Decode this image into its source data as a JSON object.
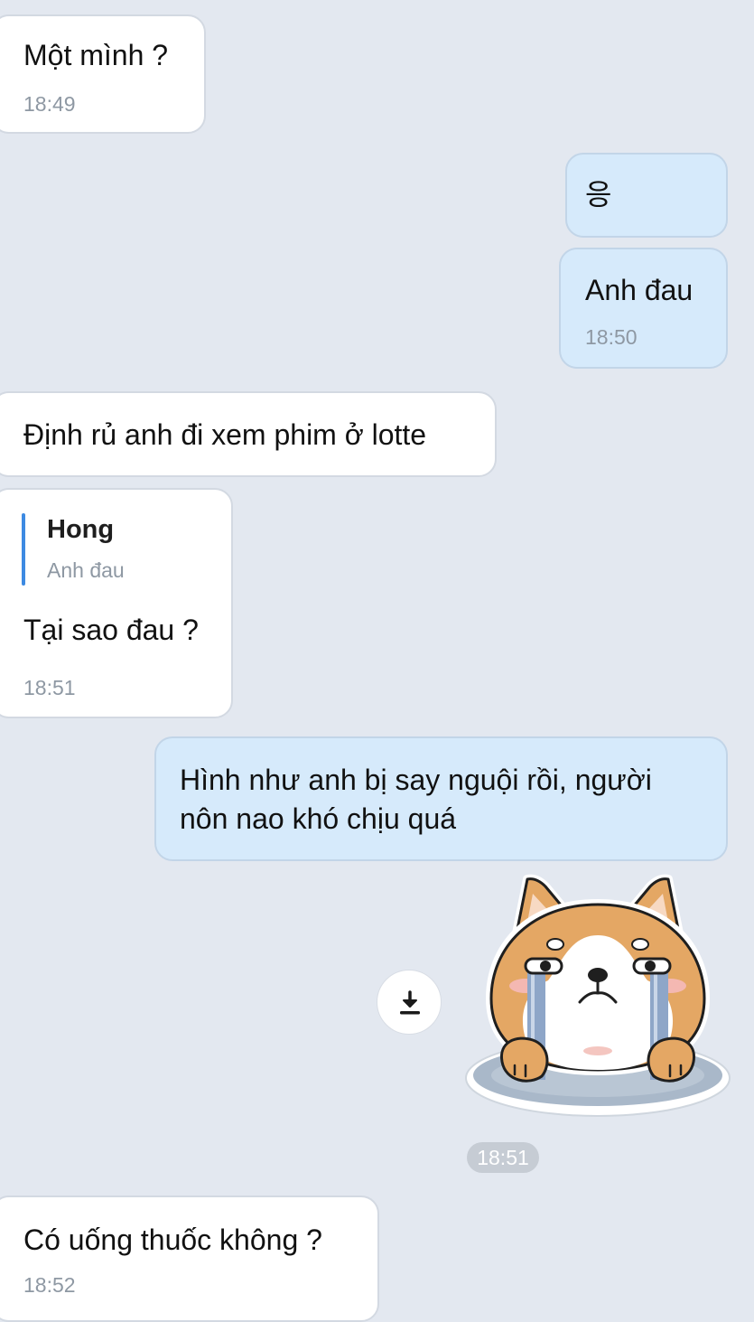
{
  "messages": [
    {
      "text": "Một mình ?",
      "time": "18:49"
    },
    {
      "text": "응"
    },
    {
      "text": "Anh đau",
      "time": "18:50"
    },
    {
      "text": "Định rủ anh đi xem phim ở lotte"
    },
    {
      "quote_name": "Hong",
      "quote_text": "Anh đau",
      "text": "Tại sao đau ?",
      "time": "18:51"
    },
    {
      "text_line1": "Hình như anh bị say nguội rồi, người",
      "text_line2": "nôn nao khó chịu quá"
    },
    {
      "sticker_time": "18:51"
    },
    {
      "text": "Có uống thuốc không ?",
      "time": "18:52"
    }
  ],
  "icons": {
    "download": "download-icon",
    "sticker": "crying-shiba-sticker"
  },
  "colors": {
    "background": "#e3e8f0",
    "incoming_bubble": "#ffffff",
    "outgoing_bubble": "#d6eafb",
    "quote_accent": "#3d8ae2",
    "timestamp": "#8e98a3"
  }
}
